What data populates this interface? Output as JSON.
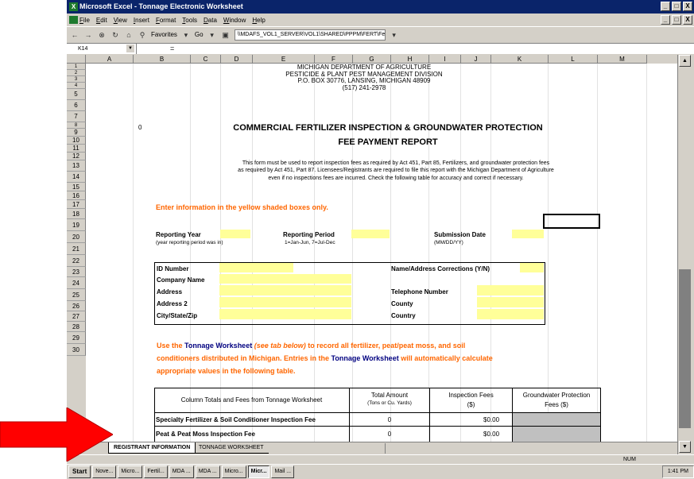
{
  "window": {
    "title": "Microsoft Excel - Tonnage Electronic Worksheet",
    "buttons": [
      "_",
      "□",
      "X"
    ]
  },
  "menu": [
    "File",
    "Edit",
    "View",
    "Insert",
    "Format",
    "Tools",
    "Data",
    "Window",
    "Help"
  ],
  "toolbar": {
    "favorites_label": "Favorites",
    "go_label": "Go",
    "address": "\\\\MDAFS_VOL1_SERVER\\VOL1\\SHARED\\PPPM\\FERT\\Fertilizer Ton\\"
  },
  "formula_bar": {
    "cell_ref": "K14",
    "equals": "="
  },
  "columns": [
    "A",
    "B",
    "C",
    "D",
    "E",
    "F",
    "G",
    "H",
    "I",
    "J",
    "K",
    "L",
    "M"
  ],
  "rows": [
    "1",
    "2",
    "3",
    "4",
    "5",
    "6",
    "7",
    "8",
    "9",
    "10",
    "11",
    "12",
    "13",
    "14",
    "15",
    "16",
    "17",
    "18",
    "19",
    "20",
    "21",
    "22",
    "23",
    "24",
    "25",
    "26",
    "27",
    "28",
    "29",
    "30"
  ],
  "sheet": {
    "header_lines": [
      "MICHIGAN DEPARTMENT OF AGRICULTURE",
      "PESTICIDE & PLANT PEST MANAGEMENT DIVISION",
      "P.O. BOX 30776, LANSING, MICHIGAN 48909",
      "(517) 241-2978"
    ],
    "cell_a6": "0",
    "title_line1": "COMMERCIAL FERTILIZER INSPECTION & GROUNDWATER PROTECTION",
    "title_line2": "FEE PAYMENT REPORT",
    "intro_line1": "This form must be used to report inspection fees as required by Act 451, Part 85, Fertilizers, and groundwater protection fees",
    "intro_line2": "as required by Act 451, Part 87.  Licensees/Registrants are required to file this report with the Michigan Department of Agriculture",
    "intro_line3": "even if no inspections fees are incurred.  Check the following table for accuracy and correct if necessary.",
    "instruction": "Enter information in the yellow shaded boxes only.",
    "reporting_year_label": "Reporting Year",
    "reporting_year_hint": "(year reporting period was in)",
    "reporting_period_label": "Reporting Period",
    "reporting_period_hint": "1=Jan-Jun, 7=Jul-Dec",
    "submission_date_label": "Submission  Date",
    "submission_date_hint": "(MM/DD/YY)",
    "id_number_label": "ID Number",
    "name_address_corrections_label": "Name/Address Corrections (Y/N)",
    "company_name_label": "Company Name",
    "address_label": "Address",
    "telephone_label": "Telephone Number",
    "address2_label": "Address 2",
    "county_label": "County",
    "city_state_zip_label": "City/State/Zip",
    "country_label": "Country",
    "worksheet_note_part1": "Use the ",
    "worksheet_note_link1": "Tonnage Worksheet",
    "worksheet_note_italic": " (see tab below)",
    "worksheet_note_part2": " to record all fertilizer, peat/peat moss, and soil",
    "worksheet_note_line2_part1": "conditioners distributed in Michigan.  Entries in the ",
    "worksheet_note_line2_link": "Tonnage Worksheet",
    "worksheet_note_line2_part2": " will automatically calculate",
    "worksheet_note_line3": "appropriate values in the following table.",
    "fees_table": {
      "col1_header": "Column Totals and Fees from Tonnage Worksheet",
      "col2_header_line1": "Total Amount",
      "col2_header_line2": "(Tons or Cu. Yards)",
      "col3_header_line1": "Inspection Fees",
      "col3_header_line2": "($)",
      "col4_header_line1": "Groundwater Protection",
      "col4_header_line2": "Fees ($)",
      "row1_label": "Specialty Fertilizer & Soil Conditioner Inspection Fee",
      "row1_amount": "0",
      "row1_fee": "$0.00",
      "row2_label": "Peat & Peat Moss Inspection Fee",
      "row2_amount": "0",
      "row2_fee": "$0.00"
    }
  },
  "sheet_tabs": {
    "active": "REGISTRANT INFORMATION",
    "other": "TONNAGE WORKSHEET"
  },
  "status": {
    "num": "NUM"
  },
  "taskbar": {
    "start": "Start",
    "tasks": [
      "Nove...",
      "Micro...",
      "Fertil...",
      "MDA ...",
      "MDA ...",
      "Micro...",
      "Micr...",
      "Mail ..."
    ],
    "clock": "1:41 PM"
  },
  "colors": {
    "highlight_yellow": "#ffff99",
    "instruction_orange": "#ff6600",
    "link_navy": "#000080",
    "arrow_red": "#ff0000"
  }
}
